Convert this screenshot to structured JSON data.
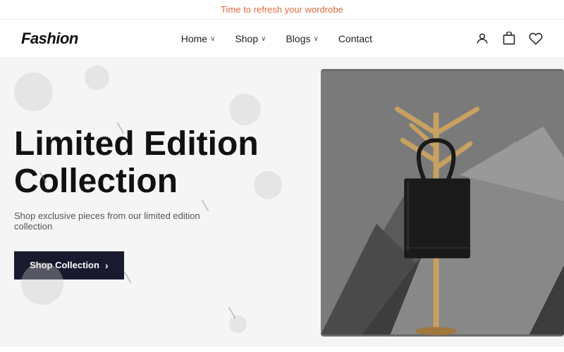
{
  "announcement": {
    "text": "Time to refresh your wordrobe"
  },
  "header": {
    "logo": "Fashion",
    "nav": [
      {
        "label": "Home",
        "has_dropdown": true
      },
      {
        "label": "Shop",
        "has_dropdown": true
      },
      {
        "label": "Blogs",
        "has_dropdown": true
      },
      {
        "label": "Contact",
        "has_dropdown": false
      }
    ],
    "icons": {
      "user": "👤",
      "cart": "🛍",
      "wishlist": "♡"
    }
  },
  "hero": {
    "title_line1": "Limited Edition",
    "title_line2": "Collection",
    "subtitle": "Shop exclusive pieces from our limited edition collection",
    "cta_label": "Shop Collection",
    "cta_arrow": "›"
  }
}
